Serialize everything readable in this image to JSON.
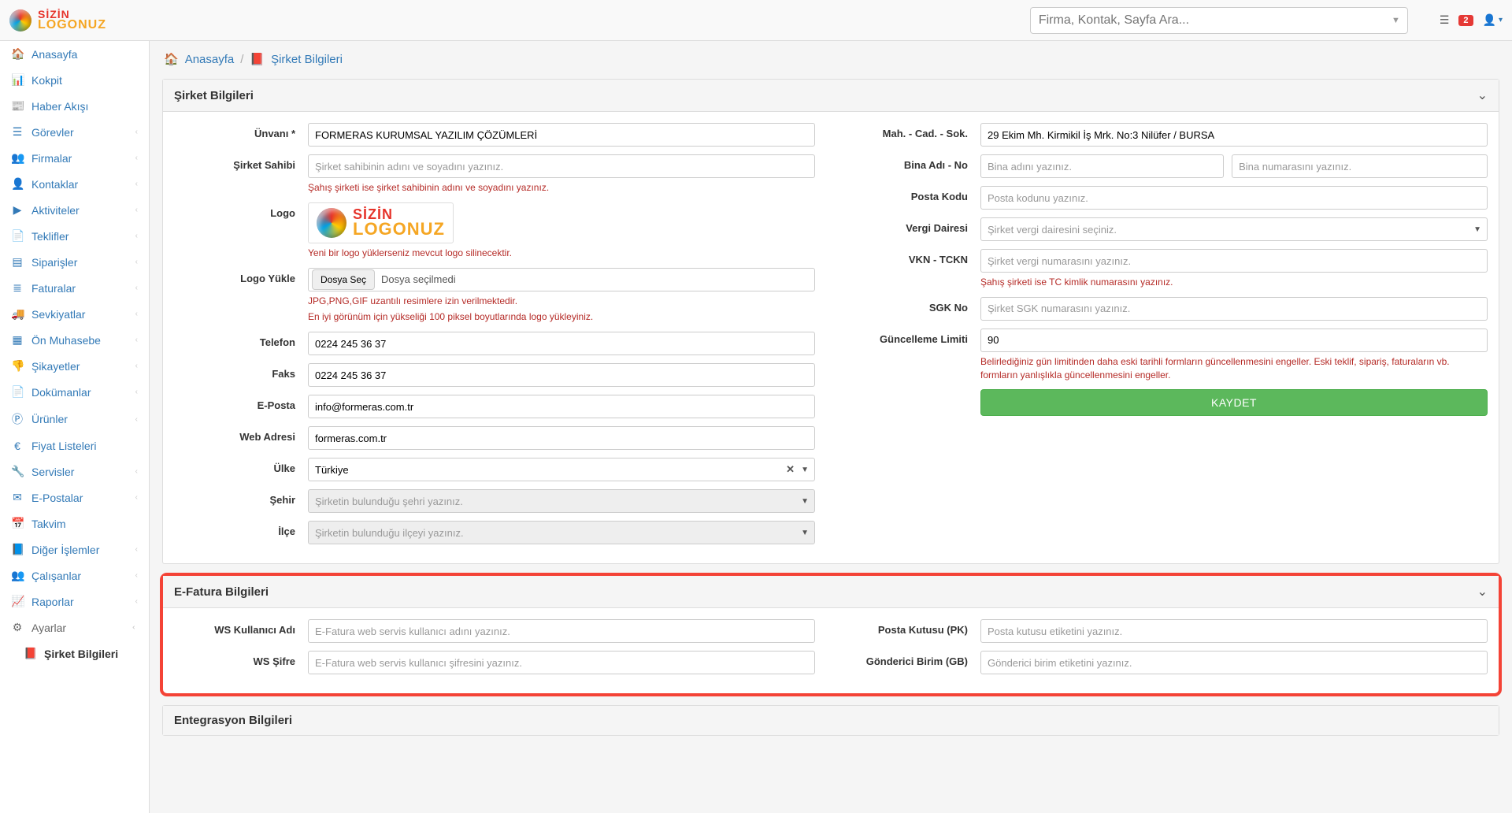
{
  "topbar": {
    "brand1": "SİZİN",
    "brand2": "LOGONUZ",
    "search_placeholder": "Firma, Kontak, Sayfa Ara...",
    "notif_count": "2"
  },
  "sidebar": [
    {
      "icon": "home",
      "label": "Anasayfa"
    },
    {
      "icon": "dash",
      "label": "Kokpit"
    },
    {
      "icon": "news",
      "label": "Haber Akışı"
    },
    {
      "icon": "tasks",
      "label": "Görevler",
      "sub": true
    },
    {
      "icon": "users",
      "label": "Firmalar",
      "sub": true
    },
    {
      "icon": "user",
      "label": "Kontaklar",
      "sub": true
    },
    {
      "icon": "play",
      "label": "Aktiviteler",
      "sub": true
    },
    {
      "icon": "file",
      "label": "Teklifler",
      "sub": true
    },
    {
      "icon": "list",
      "label": "Siparişler",
      "sub": true
    },
    {
      "icon": "list2",
      "label": "Faturalar",
      "sub": true
    },
    {
      "icon": "truck",
      "label": "Sevkiyatlar",
      "sub": true
    },
    {
      "icon": "calc",
      "label": "Ön Muhasebe",
      "sub": true
    },
    {
      "icon": "dislike",
      "label": "Şikayetler",
      "sub": true
    },
    {
      "icon": "doc",
      "label": "Dokümanlar",
      "sub": true
    },
    {
      "icon": "prod",
      "label": "Ürünler",
      "sub": true
    },
    {
      "icon": "euro",
      "label": "Fiyat Listeleri"
    },
    {
      "icon": "wrench",
      "label": "Servisler",
      "sub": true
    },
    {
      "icon": "mail",
      "label": "E-Postalar",
      "sub": true
    },
    {
      "icon": "cal",
      "label": "Takvim"
    },
    {
      "icon": "book",
      "label": "Diğer İşlemler",
      "sub": true
    },
    {
      "icon": "people",
      "label": "Çalışanlar",
      "sub": true
    },
    {
      "icon": "chart",
      "label": "Raporlar",
      "sub": true
    },
    {
      "icon": "gear",
      "label": "Ayarlar",
      "open": true
    },
    {
      "icon": "booksub",
      "label": "Şirket Bilgileri",
      "subitem": true
    }
  ],
  "breadcrumb": {
    "home": "Anasayfa",
    "current": "Şirket Bilgileri"
  },
  "panel1": {
    "title": "Şirket Bilgileri",
    "left": {
      "unvan_label": "Ünvanı *",
      "unvan_value": "FORMERAS KURUMSAL YAZILIM ÇÖZÜMLERİ",
      "sahibi_label": "Şirket Sahibi",
      "sahibi_placeholder": "Şirket sahibinin adını ve soyadını yazınız.",
      "sahibi_help": "Şahış şirketi ise şirket sahibinin adını ve soyadını yazınız.",
      "logo_label": "Logo",
      "logo_help": "Yeni bir logo yüklerseniz mevcut logo silinecektir.",
      "logo_yukle_label": "Logo Yükle",
      "dosya_sec": "Dosya Seç",
      "dosya_secilmedi": "Dosya seçilmedi",
      "logo_yukle_help1": "JPG,PNG,GIF uzantılı resimlere izin verilmektedir.",
      "logo_yukle_help2": "En iyi görünüm için yükseliği 100 piksel boyutlarında logo yükleyiniz.",
      "telefon_label": "Telefon",
      "telefon_value": "0224 245 36 37",
      "faks_label": "Faks",
      "faks_value": "0224 245 36 37",
      "eposta_label": "E-Posta",
      "eposta_value": "info@formeras.com.tr",
      "web_label": "Web Adresi",
      "web_value": "formeras.com.tr",
      "ulke_label": "Ülke",
      "ulke_value": "Türkiye",
      "sehir_label": "Şehir",
      "sehir_placeholder": "Şirketin bulunduğu şehri yazınız.",
      "ilce_label": "İlçe",
      "ilce_placeholder": "Şirketin bulunduğu ilçeyi yazınız."
    },
    "right": {
      "mah_label": "Mah. - Cad. - Sok.",
      "mah_value": "29 Ekim Mh. Kirmikil İş Mrk. No:3 Nilüfer / BURSA",
      "bina_label": "Bina Adı - No",
      "bina_adi_placeholder": "Bina adını yazınız.",
      "bina_no_placeholder": "Bina numarasını yazınız.",
      "posta_label": "Posta Kodu",
      "posta_placeholder": "Posta kodunu yazınız.",
      "vergi_d_label": "Vergi Dairesi",
      "vergi_d_placeholder": "Şirket vergi dairesini seçiniz.",
      "vkn_label": "VKN - TCKN",
      "vkn_placeholder": "Şirket vergi numarasını yazınız.",
      "vkn_help": "Şahış şirketi ise TC kimlik numarasını yazınız.",
      "sgk_label": "SGK No",
      "sgk_placeholder": "Şirket SGK numarasını yazınız.",
      "limit_label": "Güncelleme Limiti",
      "limit_value": "90",
      "limit_help": "Belirlediğiniz gün limitinden daha eski tarihli formların güncellenmesini engeller. Eski teklif, sipariş, faturaların vb. formların yanlışlıkla güncellenmesini engeller.",
      "kaydet": "KAYDET"
    }
  },
  "panel2": {
    "title": "E-Fatura Bilgileri",
    "ws_user_label": "WS Kullanıcı Adı",
    "ws_user_placeholder": "E-Fatura web servis kullanıcı adını yazınız.",
    "ws_sifre_label": "WS Şifre",
    "ws_sifre_placeholder": "E-Fatura web servis kullanıcı şifresini yazınız.",
    "pk_label": "Posta Kutusu (PK)",
    "pk_placeholder": "Posta kutusu etiketini yazınız.",
    "gb_label": "Gönderici Birim (GB)",
    "gb_placeholder": "Gönderici birim etiketini yazınız."
  },
  "panel3": {
    "title": "Entegrasyon Bilgileri"
  },
  "icons": {
    "home": "🏠",
    "dash": "📊",
    "news": "📰",
    "tasks": "☰",
    "users": "👥",
    "user": "👤",
    "play": "▶",
    "file": "📄",
    "list": "▤",
    "list2": "≣",
    "truck": "🚚",
    "calc": "▦",
    "dislike": "👎",
    "doc": "📄",
    "prod": "Ⓟ",
    "euro": "€",
    "wrench": "🔧",
    "mail": "✉",
    "cal": "📅",
    "book": "📘",
    "people": "👥",
    "chart": "📈",
    "gear": "⚙",
    "booksub": "📕"
  }
}
